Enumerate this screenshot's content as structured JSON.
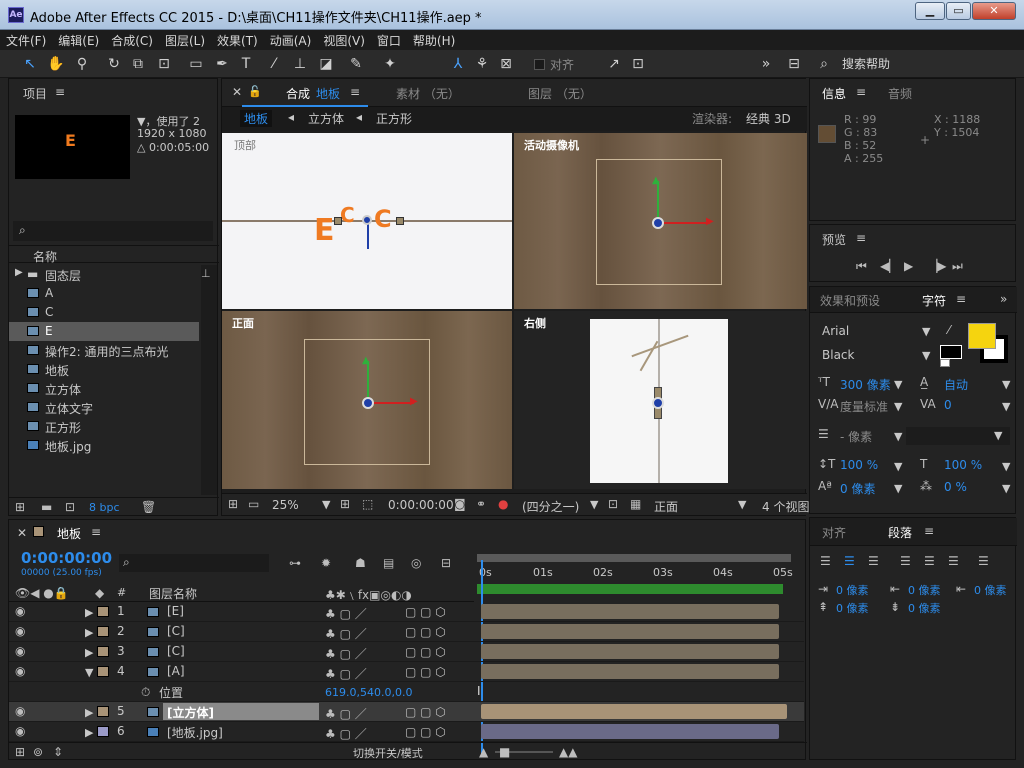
{
  "window": {
    "title": "Adobe After Effects CC 2015 - D:\\桌面\\CH11操作文件夹\\CH11操作.aep *",
    "app_icon": "Ae"
  },
  "menu": [
    "文件(F)",
    "编辑(E)",
    "合成(C)",
    "图层(L)",
    "效果(T)",
    "动画(A)",
    "视图(V)",
    "窗口",
    "帮助(H)"
  ],
  "toolbar": {
    "snap_label": "对齐",
    "search_help": "搜索帮助"
  },
  "project": {
    "tab": "项目",
    "info_line1": "▼，使用了 2",
    "info_line2": "1920 x 1080",
    "info_line3": "△ 0:00:05:00",
    "col_name": "名称",
    "items": [
      {
        "name": "固态层",
        "type": "folder"
      },
      {
        "name": "A",
        "type": "comp"
      },
      {
        "name": "C",
        "type": "comp"
      },
      {
        "name": "E",
        "type": "comp",
        "selected": true
      },
      {
        "name": "操作2: 通用的三点布光",
        "type": "comp"
      },
      {
        "name": "地板",
        "type": "comp"
      },
      {
        "name": "立方体",
        "type": "comp"
      },
      {
        "name": "立体文字",
        "type": "comp"
      },
      {
        "name": "正方形",
        "type": "comp"
      },
      {
        "name": "地板.jpg",
        "type": "image"
      }
    ],
    "bpc": "8 bpc"
  },
  "viewer": {
    "comp_label": "合成",
    "comp_name": "地板",
    "footage_tab": "素材 （无）",
    "layer_tab": "图层 （无）",
    "breadcrumbs": [
      "地板",
      "立方体",
      "正方形"
    ],
    "renderer_label": "渲染器:",
    "renderer_value": "经典 3D",
    "views": {
      "top": "顶部",
      "camera": "活动摄像机",
      "front": "正面",
      "right": "右侧"
    },
    "zoom": "25%",
    "timecode": "0:00:00:00",
    "resolution": "(四分之一)",
    "view_mode": "正面",
    "layout": "4 个视图"
  },
  "info": {
    "tab": "信息",
    "tab2": "音频",
    "r": "R : 99",
    "g": "G : 83",
    "b": "B : 52",
    "a": "A : 255",
    "x": "X : 1188",
    "y": "Y : 1504",
    "swatch_color": "#634d34"
  },
  "preview": {
    "tab": "预览"
  },
  "character": {
    "tab_effects": "效果和预设",
    "tab": "字符",
    "font": "Arial",
    "style": "Black",
    "size": "300 像素",
    "leading": "自动",
    "kerning": "度量标准",
    "tracking": "0",
    "stroke": "- 像素",
    "vscale": "100 %",
    "hscale": "100 %",
    "baseline": "0 像素",
    "tsume": "0 %",
    "fill_color": "#f5d40f"
  },
  "paragraph": {
    "tab_align": "对齐",
    "tab": "段落",
    "indent_left": "0 像素",
    "indent_first": "0 像素",
    "indent_right": "0 像素",
    "space_before": "0 像素",
    "space_after": "0 像素"
  },
  "timeline": {
    "comp_tab": "地板",
    "timecode": "0:00:00:00",
    "frame_info": "00000 (25.00 fps)",
    "col_layer_name": "图层名称",
    "ruler": [
      "0s",
      "01s",
      "02s",
      "03s",
      "04s",
      "05s"
    ],
    "layers": [
      {
        "num": "1",
        "name": "[E]",
        "color": "#a89377"
      },
      {
        "num": "2",
        "name": "[C]",
        "color": "#a89377"
      },
      {
        "num": "3",
        "name": "[C]",
        "color": "#a89377"
      },
      {
        "num": "4",
        "name": "[A]",
        "color": "#a89377"
      },
      {
        "num": "5",
        "name": "[立方体]",
        "color": "#a89377",
        "selected": true
      },
      {
        "num": "6",
        "name": "[地板.jpg]",
        "color": "#9a9ac8"
      }
    ],
    "position_label": "位置",
    "position_value": "619.0,540.0,0.0",
    "toggle_label": "切换开关/模式"
  }
}
